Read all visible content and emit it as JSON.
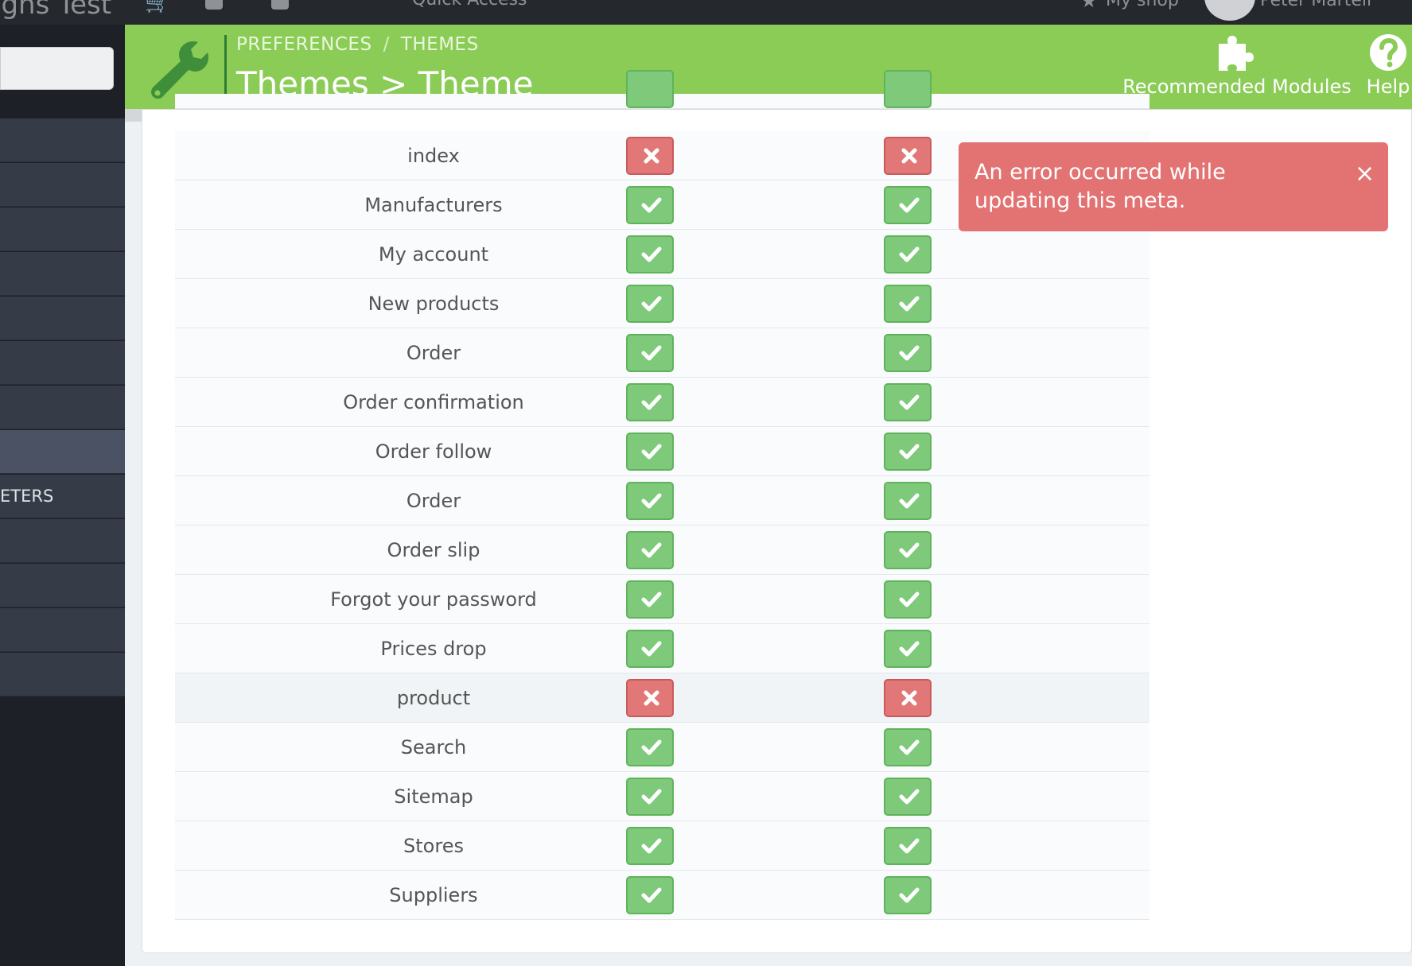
{
  "topbar": {
    "shop_name": "igns Test",
    "quick_access": "Quick Access",
    "my_shop": "My shop",
    "user": "Peter Martell"
  },
  "sidebar": {
    "items": [
      {
        "label": ""
      },
      {
        "label": ""
      },
      {
        "label": ""
      },
      {
        "label": ""
      },
      {
        "label": ""
      },
      {
        "label": ""
      },
      {
        "label": ""
      },
      {
        "label": ""
      },
      {
        "label": "ETERS"
      },
      {
        "label": ""
      },
      {
        "label": ""
      },
      {
        "label": ""
      },
      {
        "label": ""
      }
    ]
  },
  "header": {
    "breadcrumb": [
      "PREFERENCES",
      "THEMES"
    ],
    "breadcrumb_sep": "/",
    "title": "Themes > Theme",
    "recommended_modules": "Recommended Modules",
    "help": "Help",
    "accent_color": "#8bcc57"
  },
  "alert": {
    "message": "An error occurred while updating this meta.",
    "close": "×",
    "color": "#e27372"
  },
  "meta_table": {
    "rows": [
      {
        "name": "index",
        "col1": "error",
        "col2": "error"
      },
      {
        "name": "Manufacturers",
        "col1": "ok",
        "col2": "ok"
      },
      {
        "name": "My account",
        "col1": "ok",
        "col2": "ok"
      },
      {
        "name": "New products",
        "col1": "ok",
        "col2": "ok"
      },
      {
        "name": "Order",
        "col1": "ok",
        "col2": "ok"
      },
      {
        "name": "Order confirmation",
        "col1": "ok",
        "col2": "ok"
      },
      {
        "name": "Order follow",
        "col1": "ok",
        "col2": "ok"
      },
      {
        "name": "Order",
        "col1": "ok",
        "col2": "ok"
      },
      {
        "name": "Order slip",
        "col1": "ok",
        "col2": "ok"
      },
      {
        "name": "Forgot your password",
        "col1": "ok",
        "col2": "ok"
      },
      {
        "name": "Prices drop",
        "col1": "ok",
        "col2": "ok"
      },
      {
        "name": "product",
        "col1": "error",
        "col2": "error"
      },
      {
        "name": "Search",
        "col1": "ok",
        "col2": "ok"
      },
      {
        "name": "Sitemap",
        "col1": "ok",
        "col2": "ok"
      },
      {
        "name": "Stores",
        "col1": "ok",
        "col2": "ok"
      },
      {
        "name": "Suppliers",
        "col1": "ok",
        "col2": "ok"
      }
    ]
  }
}
